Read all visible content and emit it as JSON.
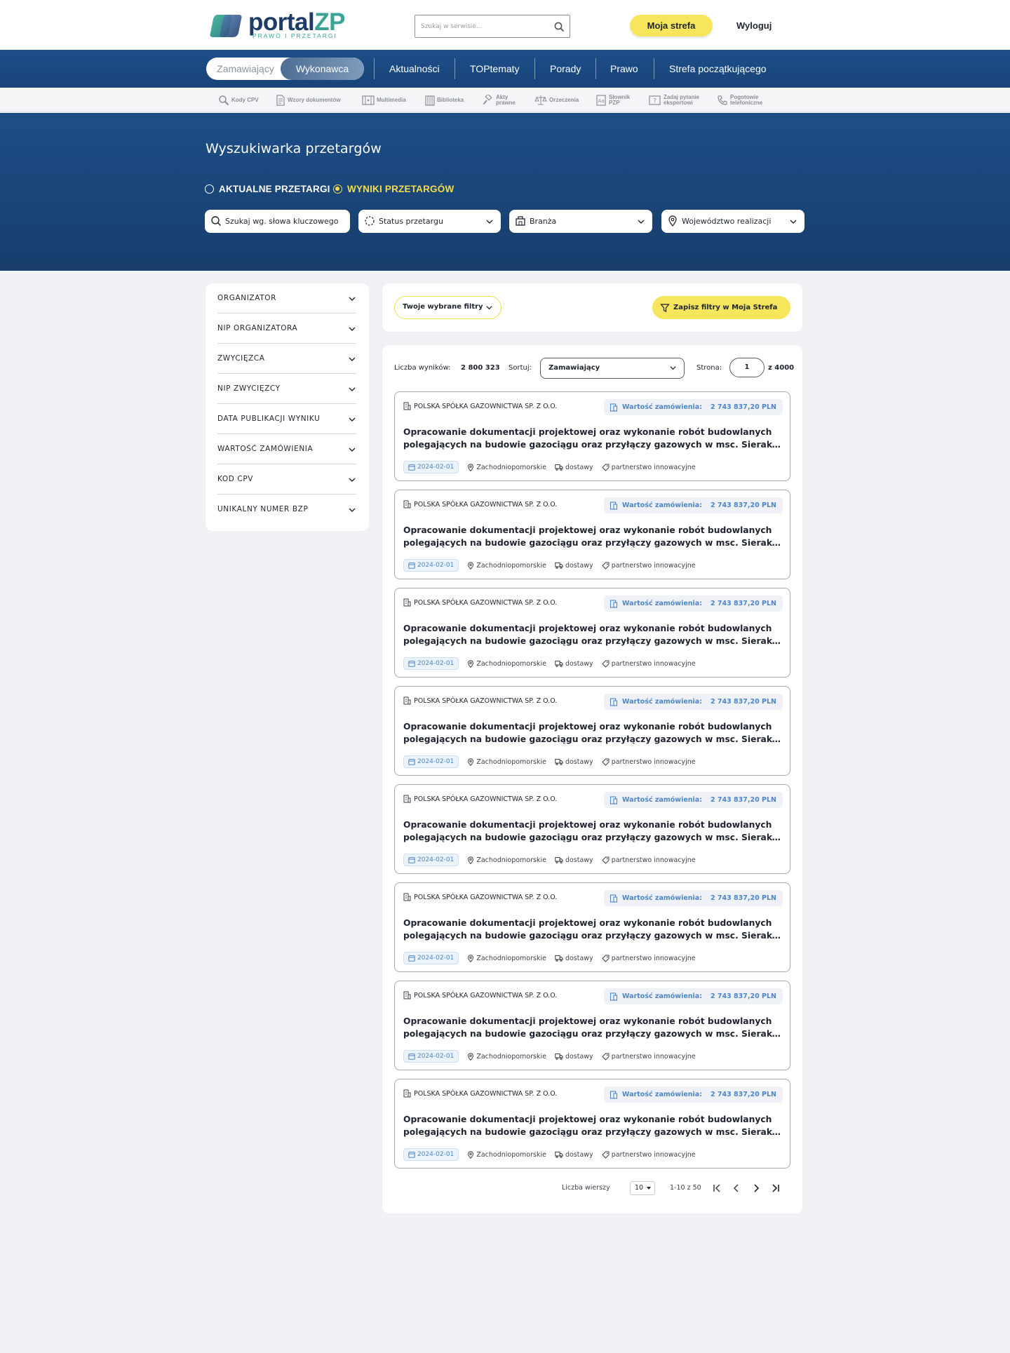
{
  "header": {
    "logo_main": "portal",
    "logo_accent": "ZP",
    "logo_sub": "PRAWO I PRZETARGI",
    "search_placeholder": "Szukaj w serwisie...",
    "my_zone": "Moja strefa",
    "logout": "Wyloguj"
  },
  "nav": {
    "toggle": [
      "Zamawiający",
      "Wykonawca"
    ],
    "items": [
      "Aktualności",
      "TOPtematy",
      "Porady",
      "Prawo",
      "Strefa początkującego"
    ]
  },
  "tools": [
    {
      "label": "Kody CPV",
      "icon": "magnifier-icon"
    },
    {
      "label": "Wzory dokumentów",
      "icon": "document-icon"
    },
    {
      "label": "Multimedia",
      "icon": "film-icon"
    },
    {
      "label": "Biblioteka",
      "icon": "books-icon"
    },
    {
      "label": "Akty\nprawne",
      "icon": "gavel-icon"
    },
    {
      "label": "Orzeczenia",
      "icon": "scales-icon"
    },
    {
      "label": "Słownik\nPZP",
      "icon": "dictionary-icon"
    },
    {
      "label": "Zadaj pytanie\nekspertowi",
      "icon": "question-icon"
    },
    {
      "label": "Pogotowie\ntelefoniczne",
      "icon": "phone-icon"
    }
  ],
  "hero": {
    "title": "Wyszukiwarka przetargów",
    "radio_current": "AKTUALNE PRZETARGI",
    "radio_results": "WYNIKI PRZETARGÓW",
    "filters": {
      "keyword": "Szukaj wg. słowa kluczowego",
      "status": "Status przetargu",
      "branch": "Branża",
      "region": "Województwo realizacji"
    }
  },
  "sidebar": {
    "items": [
      "ORGANIZATOR",
      "NIP ORGANIZATORA",
      "ZWYCIĘZCA",
      "NIP ZWYCIĘZCY",
      "DATA PUBLIKACJI WYNIKU",
      "WARTOŚĆ ZAMÓWIENIA",
      "KOD CPV",
      "UNIKALNY NUMER BZP"
    ]
  },
  "filters_bar": {
    "chosen": "Twoje wybrane filtry",
    "save": "Zapisz filtry w Moja Strefa"
  },
  "results": {
    "count_label": "Liczba wyników:",
    "count": "2 800 323",
    "sort_label": "Sortuj:",
    "sort_value": "Zamawiający",
    "page_label": "Strona:",
    "page": "1",
    "page_total": "z 4000",
    "tenders": [
      {
        "org": "POLSKA SPÓŁKA GAZOWNICTWA SP. Z O.O.",
        "value_label": "Wartość zamówienia:",
        "value": "2 743 837,20 PLN",
        "title_1": "Opracowanie dokumentacji projektowej oraz wykonanie robót budowlanych",
        "title_2": "polegających na budowie gazociągu oraz przyłączy gazowych w msc. Sierakowice ul. Kościerska",
        "date": "2024-02-01",
        "region": "Zachodniopomorskie",
        "type": "dostawy",
        "mode": "partnerstwo innowacyjne"
      },
      {
        "org": "POLSKA SPÓŁKA GAZOWNICTWA SP. Z O.O.",
        "value_label": "Wartość zamówienia:",
        "value": "2 743 837,20 PLN",
        "title_1": "Opracowanie dokumentacji projektowej oraz wykonanie robót budowlanych",
        "title_2": "polegających na budowie gazociągu oraz przyłączy gazowych w msc. Sierakowice ul. Kościerska",
        "date": "2024-02-01",
        "region": "Zachodniopomorskie",
        "type": "dostawy",
        "mode": "partnerstwo innowacyjne"
      },
      {
        "org": "POLSKA SPÓŁKA GAZOWNICTWA SP. Z O.O.",
        "value_label": "Wartość zamówienia:",
        "value": "2 743 837,20 PLN",
        "title_1": "Opracowanie dokumentacji projektowej oraz wykonanie robót budowlanych",
        "title_2": "polegających na budowie gazociągu oraz przyłączy gazowych w msc. Sierakowice ul. Kościerska",
        "date": "2024-02-01",
        "region": "Zachodniopomorskie",
        "type": "dostawy",
        "mode": "partnerstwo innowacyjne"
      },
      {
        "org": "POLSKA SPÓŁKA GAZOWNICTWA SP. Z O.O.",
        "value_label": "Wartość zamówienia:",
        "value": "2 743 837,20 PLN",
        "title_1": "Opracowanie dokumentacji projektowej oraz wykonanie robót budowlanych",
        "title_2": "polegających na budowie gazociągu oraz przyłączy gazowych w msc. Sierakowice ul. Kościerska",
        "date": "2024-02-01",
        "region": "Zachodniopomorskie",
        "type": "dostawy",
        "mode": "partnerstwo innowacyjne"
      },
      {
        "org": "POLSKA SPÓŁKA GAZOWNICTWA SP. Z O.O.",
        "value_label": "Wartość zamówienia:",
        "value": "2 743 837,20 PLN",
        "title_1": "Opracowanie dokumentacji projektowej oraz wykonanie robót budowlanych",
        "title_2": "polegających na budowie gazociągu oraz przyłączy gazowych w msc. Sierakowice ul. Kościerska",
        "date": "2024-02-01",
        "region": "Zachodniopomorskie",
        "type": "dostawy",
        "mode": "partnerstwo innowacyjne"
      },
      {
        "org": "POLSKA SPÓŁKA GAZOWNICTWA SP. Z O.O.",
        "value_label": "Wartość zamówienia:",
        "value": "2 743 837,20 PLN",
        "title_1": "Opracowanie dokumentacji projektowej oraz wykonanie robót budowlanych",
        "title_2": "polegających na budowie gazociągu oraz przyłączy gazowych w msc. Sierakowice ul. Kościerska",
        "date": "2024-02-01",
        "region": "Zachodniopomorskie",
        "type": "dostawy",
        "mode": "partnerstwo innowacyjne"
      },
      {
        "org": "POLSKA SPÓŁKA GAZOWNICTWA SP. Z O.O.",
        "value_label": "Wartość zamówienia:",
        "value": "2 743 837,20 PLN",
        "title_1": "Opracowanie dokumentacji projektowej oraz wykonanie robót budowlanych",
        "title_2": "polegających na budowie gazociągu oraz przyłączy gazowych w msc. Sierakowice ul. Kościerska",
        "date": "2024-02-01",
        "region": "Zachodniopomorskie",
        "type": "dostawy",
        "mode": "partnerstwo innowacyjne"
      },
      {
        "org": "POLSKA SPÓŁKA GAZOWNICTWA SP. Z O.O.",
        "value_label": "Wartość zamówienia:",
        "value": "2 743 837,20 PLN",
        "title_1": "Opracowanie dokumentacji projektowej oraz wykonanie robót budowlanych",
        "title_2": "polegających na budowie gazociągu oraz przyłączy gazowych w msc. Sierakowice ul. Kościerska",
        "date": "2024-02-01",
        "region": "Zachodniopomorskie",
        "type": "dostawy",
        "mode": "partnerstwo innowacyjne"
      }
    ],
    "pager": {
      "rows_label": "Liczba wierszy",
      "rows_value": "10",
      "range": "1-10 z 50"
    }
  },
  "colors": {
    "navy": "#1a4579",
    "accent_yellow": "#f7e55c",
    "link_blue": "#4e86c6",
    "teal": "#3aa396"
  }
}
